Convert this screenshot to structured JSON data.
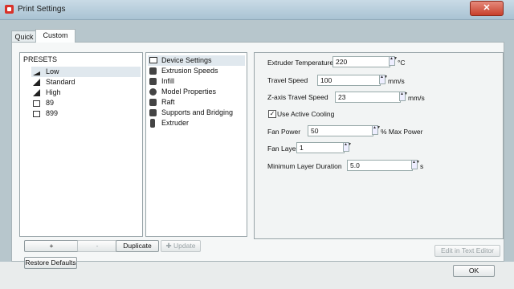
{
  "window": {
    "title": "Print Settings",
    "close_glyph": "✕"
  },
  "tabs": [
    {
      "label": "Quick"
    },
    {
      "label": "Custom"
    }
  ],
  "presets": {
    "header": "PRESETS",
    "items": [
      {
        "label": "Low",
        "icon": "signal-low-icon"
      },
      {
        "label": "Standard",
        "icon": "signal-medium-icon"
      },
      {
        "label": "High",
        "icon": "signal-high-icon"
      },
      {
        "label": "89",
        "icon": "document-icon"
      },
      {
        "label": "899",
        "icon": "document-icon"
      }
    ]
  },
  "categories": [
    {
      "label": "Device Settings",
      "icon": "device-icon"
    },
    {
      "label": "Extrusion Speeds",
      "icon": "rabbit-icon"
    },
    {
      "label": "Infill",
      "icon": "infill-icon"
    },
    {
      "label": "Model Properties",
      "icon": "gear-icon"
    },
    {
      "label": "Raft",
      "icon": "raft-icon"
    },
    {
      "label": "Supports and Bridging",
      "icon": "supports-icon"
    },
    {
      "label": "Extruder",
      "icon": "extruder-icon"
    }
  ],
  "settings": {
    "extruder_temperature": {
      "label": "Extruder Temperature",
      "value": "220",
      "unit": "°C"
    },
    "travel_speed": {
      "label": "Travel Speed",
      "value": "100",
      "unit": "mm/s"
    },
    "z_travel_speed": {
      "label": "Z-axis Travel Speed",
      "value": "23",
      "unit": "mm/s"
    },
    "active_cooling": {
      "label": "Use Active Cooling",
      "checked": true,
      "check_glyph": "✓"
    },
    "fan_power": {
      "label": "Fan Power",
      "value": "50",
      "unit": "% Max Power"
    },
    "fan_layer": {
      "label": "Fan Layer",
      "value": "1"
    },
    "min_layer_duration": {
      "label": "Minimum Layer Duration",
      "value": "5.0",
      "unit": "s"
    }
  },
  "buttons": {
    "add": "+",
    "remove": "-",
    "duplicate": "Duplicate",
    "update": "Update",
    "update_icon": "✚",
    "edit_text": "Edit in Text Editor",
    "restore": "Restore Defaults",
    "ok": "OK"
  },
  "spinner_glyph": "▲▼"
}
